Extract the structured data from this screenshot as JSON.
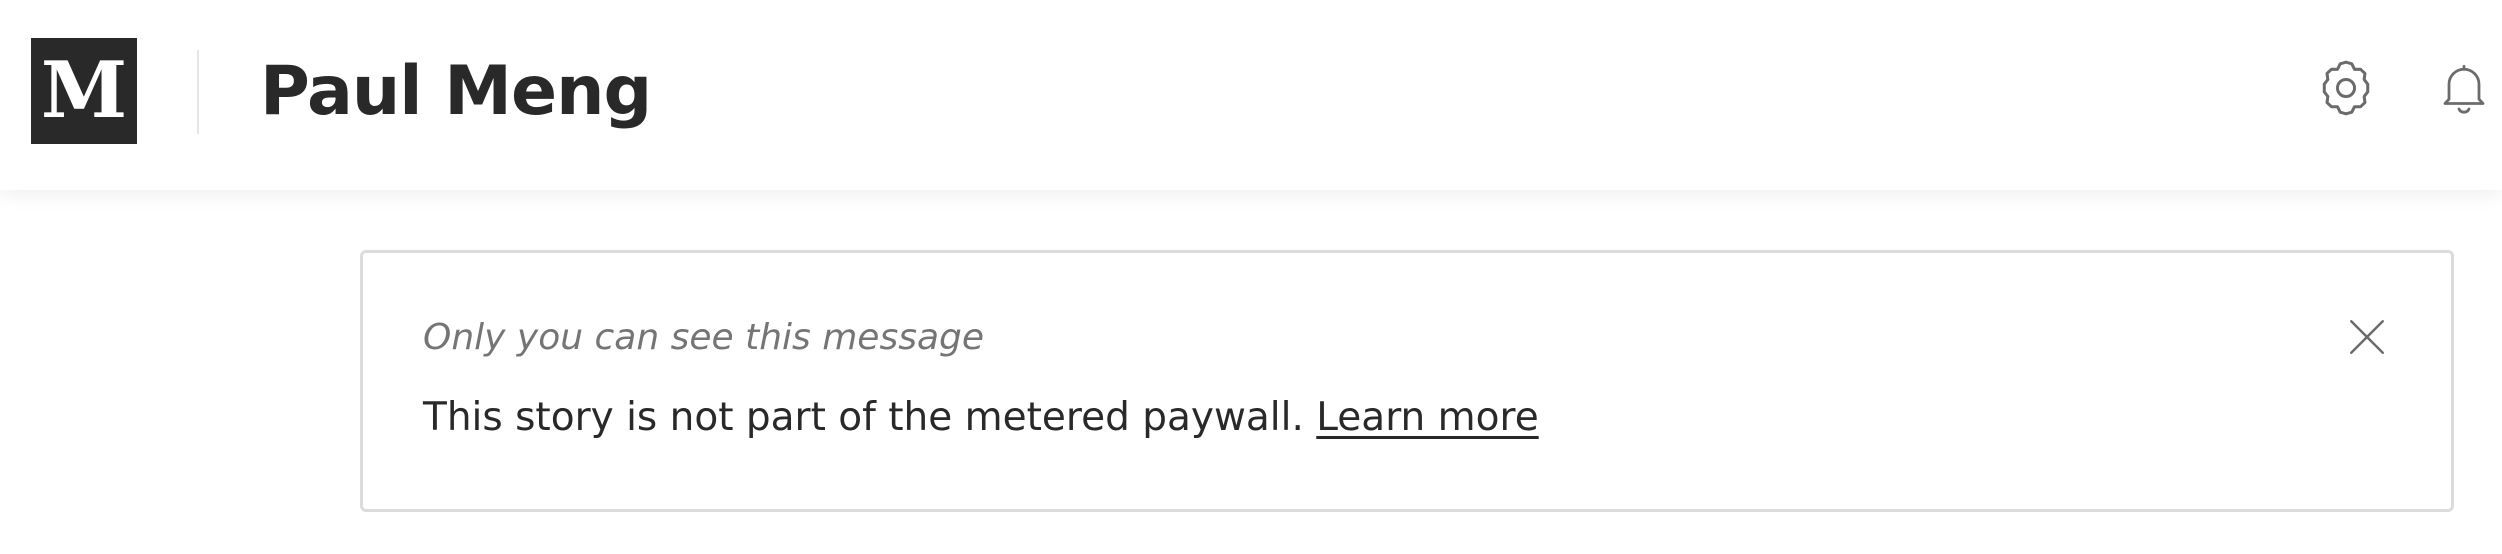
{
  "header": {
    "logo_letter": "M",
    "publication_title": "Paul Meng",
    "settings_icon": "gear-icon",
    "notifications_icon": "bell-icon"
  },
  "notice": {
    "hint": "Only you can see this message",
    "message": "This story is not part of the metered paywall.",
    "link_label": "Learn more",
    "close_icon": "close-icon"
  },
  "colors": {
    "logo_bg": "#292929",
    "text": "#292929",
    "muted_text": "#757575",
    "border": "#dcdcdc",
    "icon": "#6b6b6b"
  }
}
